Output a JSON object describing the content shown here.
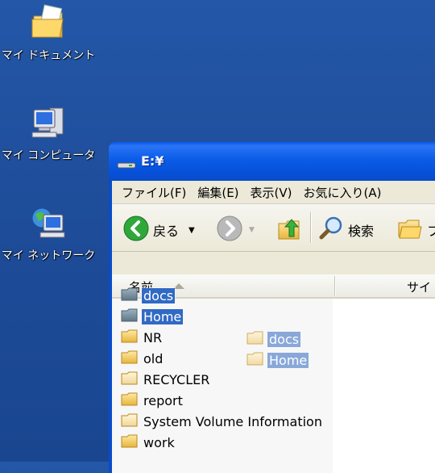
{
  "desktop": {
    "icons": [
      {
        "label": "マイ ドキュメント",
        "icon": "my-documents-icon"
      },
      {
        "label": "マイ コンピュータ",
        "icon": "my-computer-icon"
      },
      {
        "label": "マイ ネットワーク",
        "icon": "my-network-icon"
      }
    ]
  },
  "window": {
    "title": "E:¥",
    "menu": [
      "ファイル(F)",
      "編集(E)",
      "表示(V)",
      "お気に入り(A)"
    ],
    "toolbar": {
      "back_label": "戻る",
      "search_label": "検索",
      "folders_label": "フ"
    },
    "columns": {
      "name": "名前",
      "size": "サイ"
    },
    "items": [
      {
        "name": "docs",
        "icon": "shared-folder-icon",
        "state": "selected-focus"
      },
      {
        "name": "Home",
        "icon": "shared-folder-icon",
        "state": "selected"
      },
      {
        "name": "NR",
        "icon": "folder-icon",
        "state": "normal"
      },
      {
        "name": "old",
        "icon": "folder-icon",
        "state": "normal"
      },
      {
        "name": "RECYCLER",
        "icon": "hidden-folder-icon",
        "state": "normal"
      },
      {
        "name": "report",
        "icon": "folder-icon",
        "state": "normal"
      },
      {
        "name": "System Volume Information",
        "icon": "hidden-folder-icon",
        "state": "normal"
      },
      {
        "name": "work",
        "icon": "folder-icon",
        "state": "normal"
      }
    ],
    "drag_ghost": [
      "docs",
      "Home"
    ]
  }
}
